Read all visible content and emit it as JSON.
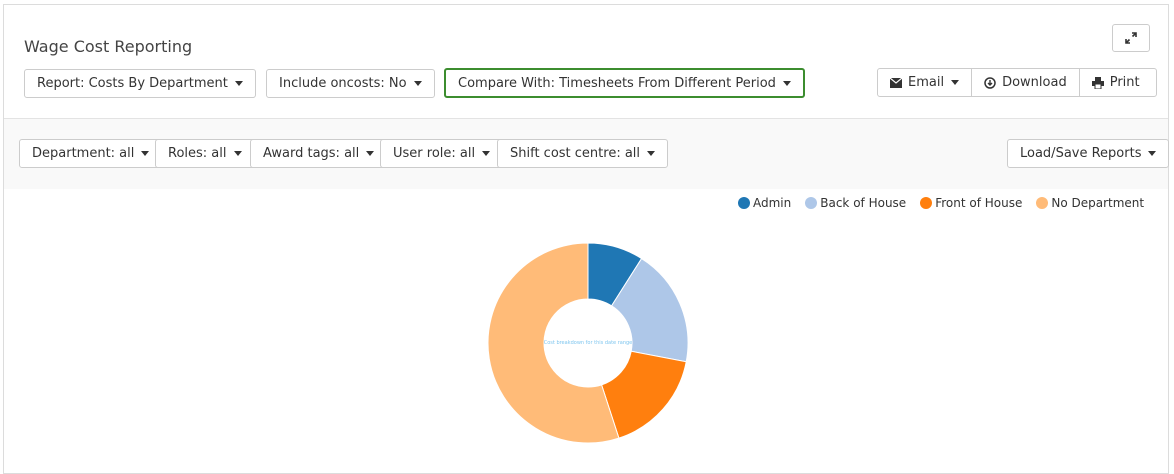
{
  "header": {
    "title": "Wage Cost Reporting"
  },
  "toolbar": {
    "report": "Report: Costs By Department",
    "oncosts": "Include oncosts: No",
    "compare": "Compare With: Timesheets From Different Period",
    "email": "Email",
    "download": "Download",
    "print": "Print"
  },
  "filters": {
    "department": "Department: all",
    "roles": "Roles: all",
    "award_tags": "Award tags: all",
    "user_role": "User role: all",
    "shift_cost_centre": "Shift cost centre: all",
    "load_save": "Load/Save Reports"
  },
  "chart_data": {
    "type": "pie",
    "donut": true,
    "center_label": "Cost breakdown for this date range",
    "legend_position": "top-right",
    "categories": [
      "Admin",
      "Back of House",
      "Front of House",
      "No Department"
    ],
    "values": [
      9,
      19,
      17,
      55
    ],
    "colors": [
      "#1f77b4",
      "#aec7e8",
      "#ff7f0e",
      "#ffbb78"
    ]
  }
}
